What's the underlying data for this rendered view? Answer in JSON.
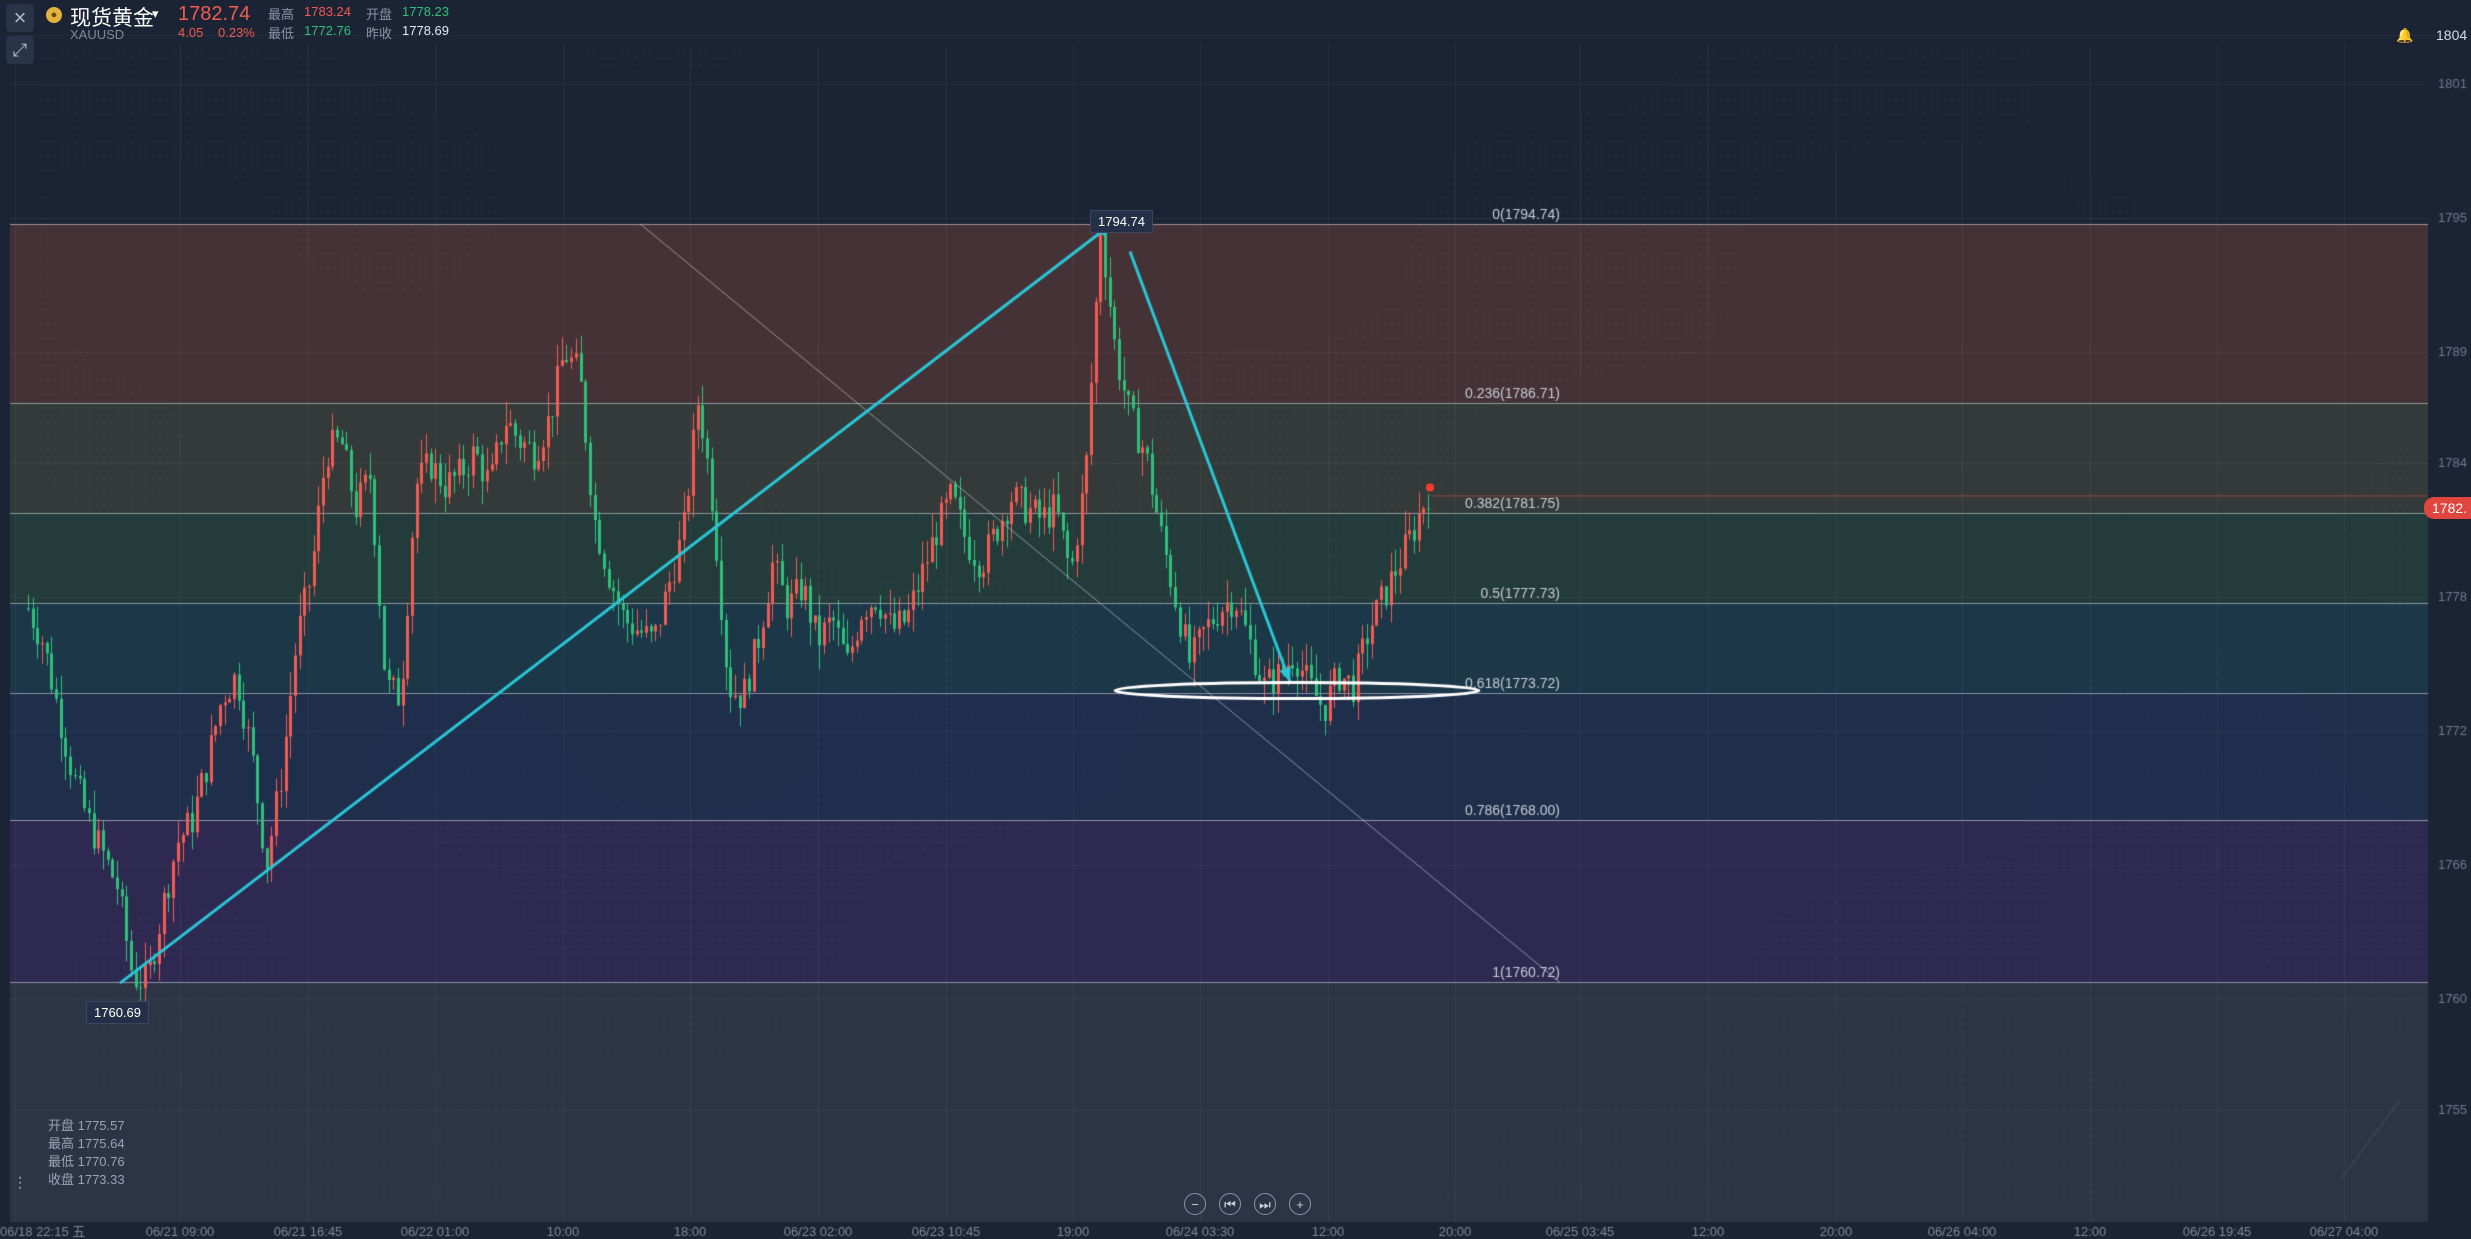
{
  "header": {
    "close_icon": "close-icon",
    "expand_icon": "expand-icon",
    "coin_icon": "gold-coin-icon",
    "coin_glyph": "●",
    "symbol_name": "现货黄金",
    "caret": "▾",
    "symbol_code": "XAUUSD",
    "price": "1782.74",
    "change": "4.05",
    "change_pct": "0.23%",
    "stats": [
      {
        "label": "最高",
        "value": "1783.24",
        "color": "red"
      },
      {
        "label": "开盘",
        "value": "1778.23",
        "color": "green"
      },
      {
        "label": "最低",
        "value": "1772.76",
        "color": "green"
      },
      {
        "label": "昨收",
        "value": "1778.69",
        "color": "white"
      }
    ],
    "bell_icon": "bell-icon",
    "top_axis_price": "1804"
  },
  "ohlc_panel": {
    "open": "开盘 1775.57",
    "high": "最高 1775.64",
    "low": "最低 1770.76",
    "close": "收盘 1773.33"
  },
  "nav_buttons": [
    {
      "icon": "zoom-out-icon",
      "glyph": "−"
    },
    {
      "icon": "first-page-icon",
      "glyph": "⏮"
    },
    {
      "icon": "last-page-icon",
      "glyph": "⏭"
    },
    {
      "icon": "zoom-in-icon",
      "glyph": "+"
    }
  ],
  "current_price_tag": "1782.",
  "colors": {
    "background": "#1b2434",
    "up": "#f25a52",
    "down": "#2ec07a",
    "trendline": "#29c6d6",
    "fib_line": "#b9c0cc"
  },
  "chart_data": {
    "type": "candlestick",
    "instrument": "XAUUSD",
    "ylim": [
      1755,
      1805
    ],
    "y_ticks": [
      1755,
      1760,
      1766,
      1772,
      1778,
      1784,
      1789,
      1795,
      1801
    ],
    "x_ticks": [
      "06/18 22:15 五",
      "06/21 09:00",
      "06/21 16:45",
      "06/22 01:00",
      "10:00",
      "18:00",
      "06/23 02:00",
      "06/23 10:45",
      "19:00",
      "06/24 03:30",
      "12:00",
      "20:00",
      "06/25 03:45",
      "12:00",
      "20:00",
      "06/26 04:00",
      "12:00",
      "06/26 19:45",
      "06/27 04:00"
    ],
    "swing_low": 1760.69,
    "swing_high": 1794.74,
    "swing_low_label": "1760.69",
    "swing_high_label": "1794.74",
    "fib_levels": [
      {
        "ratio": "0",
        "value": 1794.74,
        "label": "0(1794.74)"
      },
      {
        "ratio": "0.236",
        "value": 1786.71,
        "label": "0.236(1786.71)"
      },
      {
        "ratio": "0.382",
        "value": 1781.75,
        "label": "0.382(1781.75)"
      },
      {
        "ratio": "0.5",
        "value": 1777.73,
        "label": "0.5(1777.73)"
      },
      {
        "ratio": "0.618",
        "value": 1773.72,
        "label": "0.618(1773.72)"
      },
      {
        "ratio": "0.786",
        "value": 1768.0,
        "label": "0.786(1768.00)"
      },
      {
        "ratio": "1",
        "value": 1760.72,
        "label": "1(1760.72)"
      }
    ],
    "price_path": [
      1777.5,
      1776,
      1773,
      1770,
      1768,
      1766.5,
      1765,
      1761,
      1760.7,
      1764,
      1767,
      1768,
      1770.5,
      1773.5,
      1774.5,
      1771,
      1766,
      1770,
      1776,
      1779,
      1784.5,
      1785,
      1782,
      1783.5,
      1774,
      1773.5,
      1783,
      1784,
      1783,
      1783.5,
      1784.5,
      1783,
      1786,
      1785,
      1784.5,
      1786,
      1789,
      1788,
      1781.5,
      1779,
      1777,
      1776.5,
      1776,
      1778.5,
      1781,
      1787,
      1782,
      1774,
      1773.5,
      1776,
      1779.5,
      1777.5,
      1778.5,
      1776,
      1777,
      1775,
      1777.5,
      1778,
      1776.5,
      1777,
      1779,
      1781,
      1782.5,
      1780.5,
      1779.5,
      1781,
      1782.5,
      1782,
      1781.5,
      1782,
      1779,
      1783.5,
      1794.74,
      1789,
      1786,
      1784.5,
      1781,
      1778,
      1775,
      1776.5,
      1777.5,
      1778,
      1776,
      1774,
      1774.5,
      1775.5,
      1774,
      1773,
      1774.5,
      1774,
      1776.5,
      1778,
      1779.5,
      1781,
      1782.74
    ],
    "drawn_lines": [
      {
        "from": "1760.69 swing low",
        "to": "1794.74 swing high",
        "color": "cyan"
      },
      {
        "from": "1794.74 swing high",
        "to": "near 0.618 level",
        "color": "cyan"
      }
    ]
  }
}
